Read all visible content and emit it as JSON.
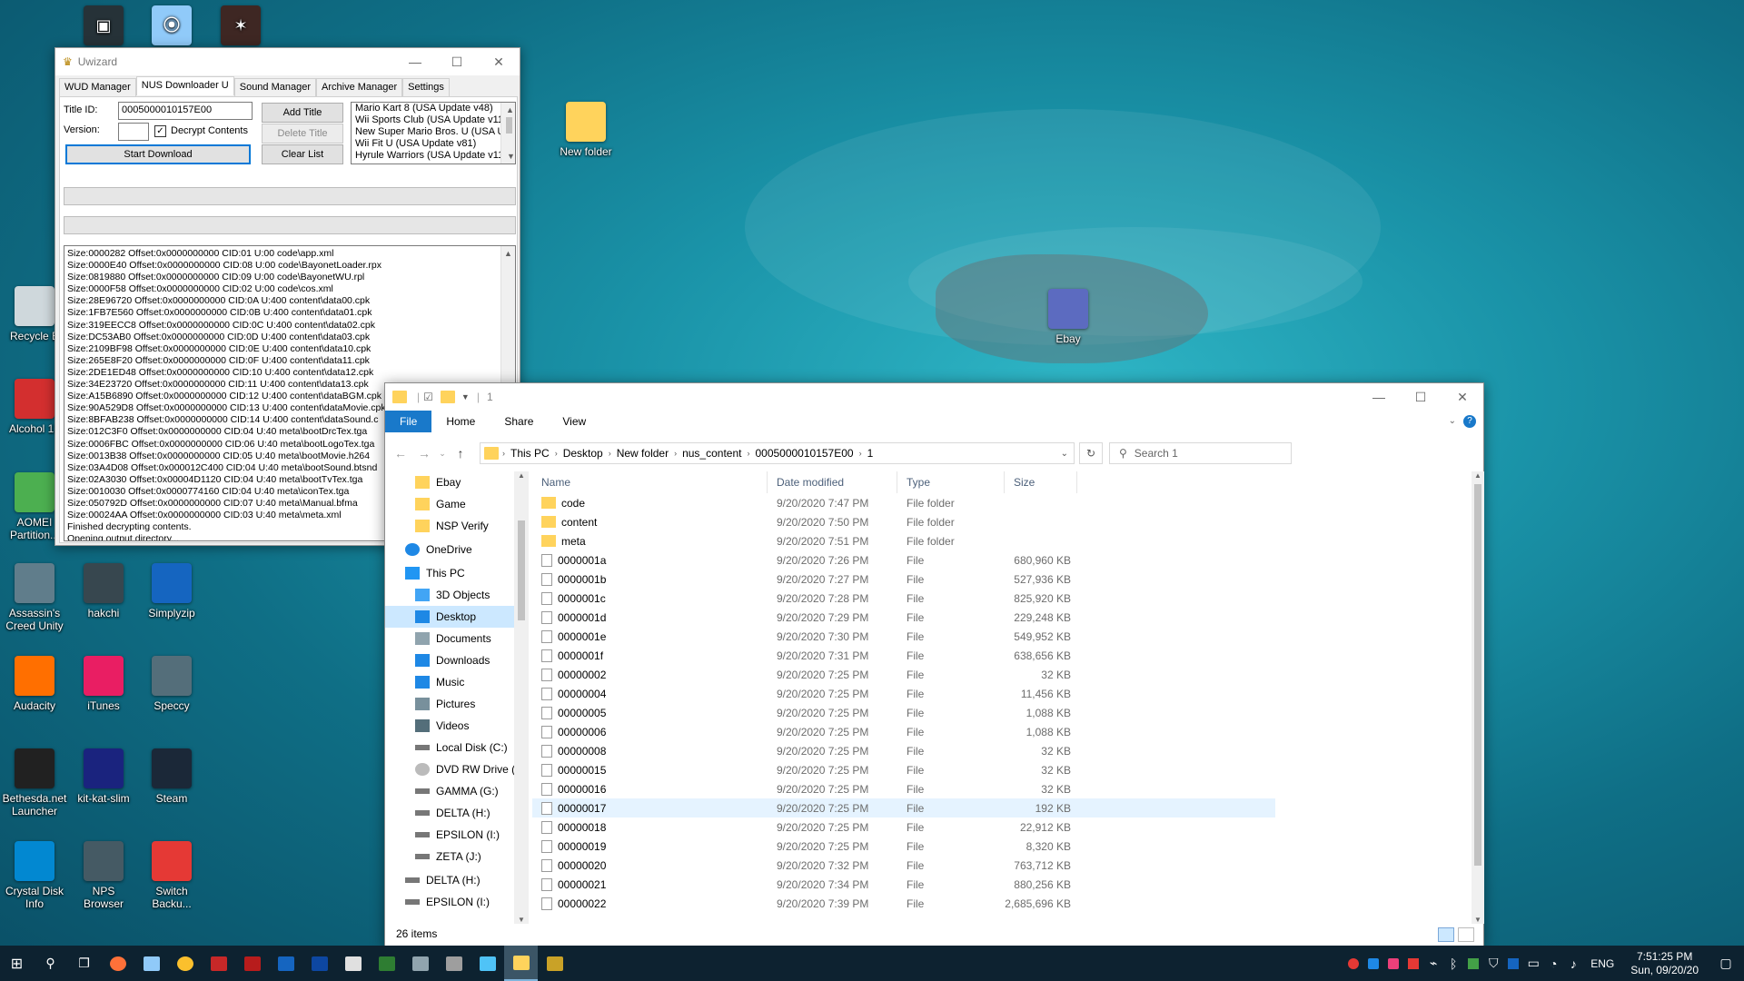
{
  "desktop": {
    "icons": [
      {
        "label": "Recycle B",
        "color": "#cfd8dc"
      },
      {
        "label": "Alcohol 12",
        "color": "#d32f2f"
      },
      {
        "label": "AOMEI Partition...",
        "color": "#4caf50"
      },
      {
        "label": "Assassin's Creed Unity",
        "color": "#607d8b"
      },
      {
        "label": "hakchi",
        "color": "#37474f"
      },
      {
        "label": "Simplyzip",
        "color": "#1565c0"
      },
      {
        "label": "Audacity",
        "color": "#ff6f00"
      },
      {
        "label": "iTunes",
        "color": "#e91e63"
      },
      {
        "label": "Speccy",
        "color": "#546e7a"
      },
      {
        "label": "Bethesda.net Launcher",
        "color": "#212121"
      },
      {
        "label": "kit-kat-slim",
        "color": "#1a237e"
      },
      {
        "label": "Steam",
        "color": "#1b2838"
      },
      {
        "label": "Crystal Disk Info",
        "color": "#0288d1"
      },
      {
        "label": "NPS Browser",
        "color": "#455a64"
      },
      {
        "label": "Switch Backu...",
        "color": "#e53935"
      },
      {
        "label": "New folder",
        "color": "#ffd35c"
      },
      {
        "label": "Ebay",
        "color": "#5c6bc0"
      }
    ]
  },
  "uwizard": {
    "title": "Uwizard",
    "tabs": [
      "WUD Manager",
      "NUS Downloader U",
      "Sound Manager",
      "Archive Manager",
      "Settings"
    ],
    "title_id_label": "Title ID:",
    "title_id_value": "0005000010157E00",
    "version_label": "Version:",
    "version_value": "",
    "decrypt_label": "Decrypt Contents",
    "add_title": "Add Title",
    "delete_title": "Delete Title",
    "clear_list": "Clear List",
    "start_download": "Start Download",
    "queue": [
      "Mario Kart 8 (USA Update v48)",
      "Wii Sports Club (USA Update v112)",
      "New Super Mario Bros. U (USA Up",
      "Wii Fit U (USA Update v81)",
      "Hyrule Warriors (USA Update v112"
    ],
    "log": [
      "Size:0000282 Offset:0x0000000000 CID:01 U:00 code\\app.xml",
      "Size:0000E40 Offset:0x0000000000 CID:08 U:00 code\\BayonetLoader.rpx",
      "Size:0819880 Offset:0x0000000000 CID:09 U:00 code\\BayonetWU.rpl",
      "Size:0000F58 Offset:0x0000000000 CID:02 U:00 code\\cos.xml",
      "Size:28E96720 Offset:0x0000000000 CID:0A U:400 content\\data00.cpk",
      "Size:1FB7E560 Offset:0x0000000000 CID:0B U:400 content\\data01.cpk",
      "Size:319EECC8 Offset:0x0000000000 CID:0C U:400 content\\data02.cpk",
      "Size:DC53AB0 Offset:0x0000000000 CID:0D U:400 content\\data03.cpk",
      "Size:2109BF98 Offset:0x0000000000 CID:0E U:400 content\\data10.cpk",
      "Size:265E8F20 Offset:0x0000000000 CID:0F U:400 content\\data11.cpk",
      "Size:2DE1ED48 Offset:0x0000000000 CID:10 U:400 content\\data12.cpk",
      "Size:34E23720 Offset:0x0000000000 CID:11 U:400 content\\data13.cpk",
      "Size:A15B6890 Offset:0x0000000000 CID:12 U:400 content\\dataBGM.cpk",
      "Size:90A529D8 Offset:0x0000000000 CID:13 U:400 content\\dataMovie.cpk",
      "Size:8BFAB238 Offset:0x0000000000 CID:14 U:400 content\\dataSound.c",
      "Size:012C3F0 Offset:0x0000000000 CID:04 U:40 meta\\bootDrcTex.tga",
      "Size:0006FBC Offset:0x0000000000 CID:06 U:40 meta\\bootLogoTex.tga",
      "Size:0013B38 Offset:0x0000000000 CID:05 U:40 meta\\bootMovie.h264",
      "Size:03A4D08 Offset:0x000012C400 CID:04 U:40 meta\\bootSound.btsnd",
      "Size:02A3030 Offset:0x00004D1120 CID:04 U:40 meta\\bootTvTex.tga",
      "Size:0010030 Offset:0x0000774160 CID:04 U:40 meta\\iconTex.tga",
      "Size:050792D Offset:0x0000000000 CID:07 U:40 meta\\Manual.bfma",
      "Size:00024AA Offset:0x0000000000 CID:03 U:40 meta\\meta.xml",
      "Finished decrypting contents.",
      "Opening output directory..."
    ]
  },
  "explorer": {
    "title": "1",
    "ribbon_tabs": [
      "File",
      "Home",
      "Share",
      "View"
    ],
    "breadcrumb": [
      "This PC",
      "Desktop",
      "New folder",
      "nus_content",
      "0005000010157E00",
      "1"
    ],
    "search_placeholder": "Search 1",
    "nav": [
      {
        "label": "Ebay",
        "kind": "folder",
        "indent": 1
      },
      {
        "label": "Game",
        "kind": "folder",
        "indent": 1
      },
      {
        "label": "NSP Verify",
        "kind": "folder",
        "indent": 1
      },
      {
        "label": "OneDrive",
        "kind": "cloud",
        "indent": 0
      },
      {
        "label": "This PC",
        "kind": "pc",
        "indent": 0
      },
      {
        "label": "3D Objects",
        "kind": "obj",
        "indent": 1
      },
      {
        "label": "Desktop",
        "kind": "desk",
        "indent": 1,
        "selected": true
      },
      {
        "label": "Documents",
        "kind": "doc",
        "indent": 1
      },
      {
        "label": "Downloads",
        "kind": "dl",
        "indent": 1
      },
      {
        "label": "Music",
        "kind": "music",
        "indent": 1
      },
      {
        "label": "Pictures",
        "kind": "pic",
        "indent": 1
      },
      {
        "label": "Videos",
        "kind": "vid",
        "indent": 1
      },
      {
        "label": "Local Disk (C:)",
        "kind": "drive",
        "indent": 1
      },
      {
        "label": "DVD RW Drive (D",
        "kind": "dvd",
        "indent": 1
      },
      {
        "label": "GAMMA (G:)",
        "kind": "drive",
        "indent": 1
      },
      {
        "label": "DELTA (H:)",
        "kind": "drive",
        "indent": 1
      },
      {
        "label": "EPSILON (I:)",
        "kind": "drive",
        "indent": 1
      },
      {
        "label": "ZETA (J:)",
        "kind": "drive",
        "indent": 1
      },
      {
        "label": "DELTA (H:)",
        "kind": "drive",
        "indent": 0
      },
      {
        "label": "EPSILON (I:)",
        "kind": "drive",
        "indent": 0
      }
    ],
    "columns": [
      "Name",
      "Date modified",
      "Type",
      "Size"
    ],
    "files": [
      {
        "name": "code",
        "date": "9/20/2020 7:47 PM",
        "type": "File folder",
        "size": "",
        "folder": true
      },
      {
        "name": "content",
        "date": "9/20/2020 7:50 PM",
        "type": "File folder",
        "size": "",
        "folder": true
      },
      {
        "name": "meta",
        "date": "9/20/2020 7:51 PM",
        "type": "File folder",
        "size": "",
        "folder": true
      },
      {
        "name": "0000001a",
        "date": "9/20/2020 7:26 PM",
        "type": "File",
        "size": "680,960 KB"
      },
      {
        "name": "0000001b",
        "date": "9/20/2020 7:27 PM",
        "type": "File",
        "size": "527,936 KB"
      },
      {
        "name": "0000001c",
        "date": "9/20/2020 7:28 PM",
        "type": "File",
        "size": "825,920 KB"
      },
      {
        "name": "0000001d",
        "date": "9/20/2020 7:29 PM",
        "type": "File",
        "size": "229,248 KB"
      },
      {
        "name": "0000001e",
        "date": "9/20/2020 7:30 PM",
        "type": "File",
        "size": "549,952 KB"
      },
      {
        "name": "0000001f",
        "date": "9/20/2020 7:31 PM",
        "type": "File",
        "size": "638,656 KB"
      },
      {
        "name": "00000002",
        "date": "9/20/2020 7:25 PM",
        "type": "File",
        "size": "32 KB"
      },
      {
        "name": "00000004",
        "date": "9/20/2020 7:25 PM",
        "type": "File",
        "size": "11,456 KB"
      },
      {
        "name": "00000005",
        "date": "9/20/2020 7:25 PM",
        "type": "File",
        "size": "1,088 KB"
      },
      {
        "name": "00000006",
        "date": "9/20/2020 7:25 PM",
        "type": "File",
        "size": "1,088 KB"
      },
      {
        "name": "00000008",
        "date": "9/20/2020 7:25 PM",
        "type": "File",
        "size": "32 KB"
      },
      {
        "name": "00000015",
        "date": "9/20/2020 7:25 PM",
        "type": "File",
        "size": "32 KB"
      },
      {
        "name": "00000016",
        "date": "9/20/2020 7:25 PM",
        "type": "File",
        "size": "32 KB"
      },
      {
        "name": "00000017",
        "date": "9/20/2020 7:25 PM",
        "type": "File",
        "size": "192 KB",
        "hover": true
      },
      {
        "name": "00000018",
        "date": "9/20/2020 7:25 PM",
        "type": "File",
        "size": "22,912 KB"
      },
      {
        "name": "00000019",
        "date": "9/20/2020 7:25 PM",
        "type": "File",
        "size": "8,320 KB"
      },
      {
        "name": "00000020",
        "date": "9/20/2020 7:32 PM",
        "type": "File",
        "size": "763,712 KB"
      },
      {
        "name": "00000021",
        "date": "9/20/2020 7:34 PM",
        "type": "File",
        "size": "880,256 KB"
      },
      {
        "name": "00000022",
        "date": "9/20/2020 7:39 PM",
        "type": "File",
        "size": "2,685,696 KB"
      }
    ],
    "item_count": "26 items"
  },
  "taskbar": {
    "lang": "ENG",
    "time": "7:51:25 PM",
    "date": "Sun, 09/20/20"
  }
}
